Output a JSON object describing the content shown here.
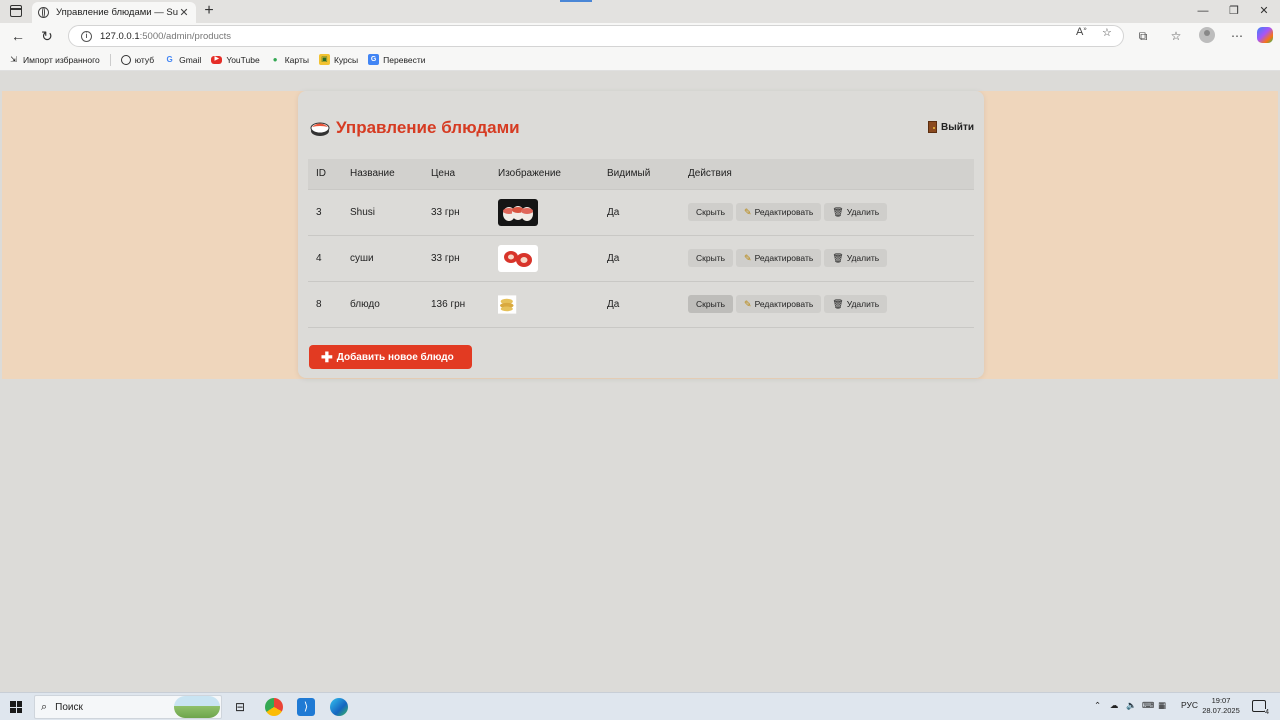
{
  "browser": {
    "tab_title": "Управление блюдами — SushiT",
    "tab_close": "✕",
    "new_tab": "+",
    "url_host": "127.0.0.1",
    "url_path": ":5000/admin/products",
    "bookmarks": [
      {
        "label": "Импорт избранного",
        "icon": "import-icon"
      },
      {
        "label": "ютуб",
        "icon": "globe-icon"
      },
      {
        "label": "Gmail",
        "icon": "google-icon"
      },
      {
        "label": "YouTube",
        "icon": "youtube-icon"
      },
      {
        "label": "Карты",
        "icon": "maps-pin-icon"
      },
      {
        "label": "Курсы",
        "icon": "courses-icon"
      },
      {
        "label": "Перевести",
        "icon": "translate-icon"
      }
    ]
  },
  "admin": {
    "title": "Управление блюдами",
    "logout": "Выйти",
    "columns": [
      "ID",
      "Название",
      "Цена",
      "Изображение",
      "Видимый",
      "Действия"
    ],
    "rows": [
      {
        "id": "3",
        "name": "Shusi",
        "price": "33 грн",
        "visible": "Да",
        "hide": "Скрыть",
        "edit": "Редактировать",
        "delete": "Удалить"
      },
      {
        "id": "4",
        "name": "суши",
        "price": "33 грн",
        "visible": "Да",
        "hide": "Скрыть",
        "edit": "Редактировать",
        "delete": "Удалить"
      },
      {
        "id": "8",
        "name": "блюдо",
        "price": "136 грн",
        "visible": "Да",
        "hide": "Скрыть",
        "edit": "Редактировать",
        "delete": "Удалить"
      }
    ],
    "add_button": "Добавить новое блюдо"
  },
  "taskbar": {
    "search_placeholder": "Поиск",
    "language": "РУС",
    "time": "19:07",
    "date": "28.07.2025",
    "notifications": "4"
  },
  "colors": {
    "accent": "#e23a22",
    "title": "#d63b22",
    "peach": "#efd6bc",
    "page": "#dcdbd8"
  }
}
